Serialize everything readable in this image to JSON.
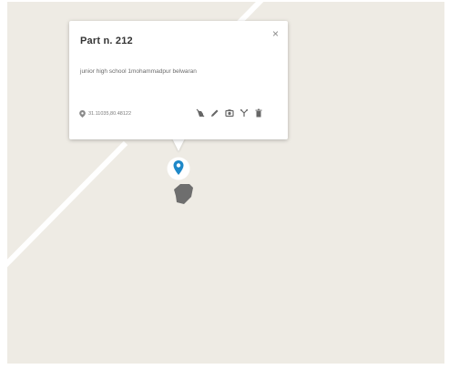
{
  "popup": {
    "title": "Part n. 212",
    "close": "×",
    "description": "junior high school 1mohammadpur belwaran",
    "coordinates": "31.11035,80.48122"
  },
  "toolbar": [
    {
      "name": "no-photo-icon",
      "label": ""
    },
    {
      "name": "edit-icon",
      "label": ""
    },
    {
      "name": "camera-icon",
      "label": ""
    },
    {
      "name": "split-icon",
      "label": ""
    },
    {
      "name": "delete-icon",
      "label": ""
    }
  ],
  "colors": {
    "map_background": "#eeebe4",
    "road": "#ffffff",
    "marker": "#1e88c8",
    "parcel": "#6e6e6e",
    "icon": "#666666"
  }
}
